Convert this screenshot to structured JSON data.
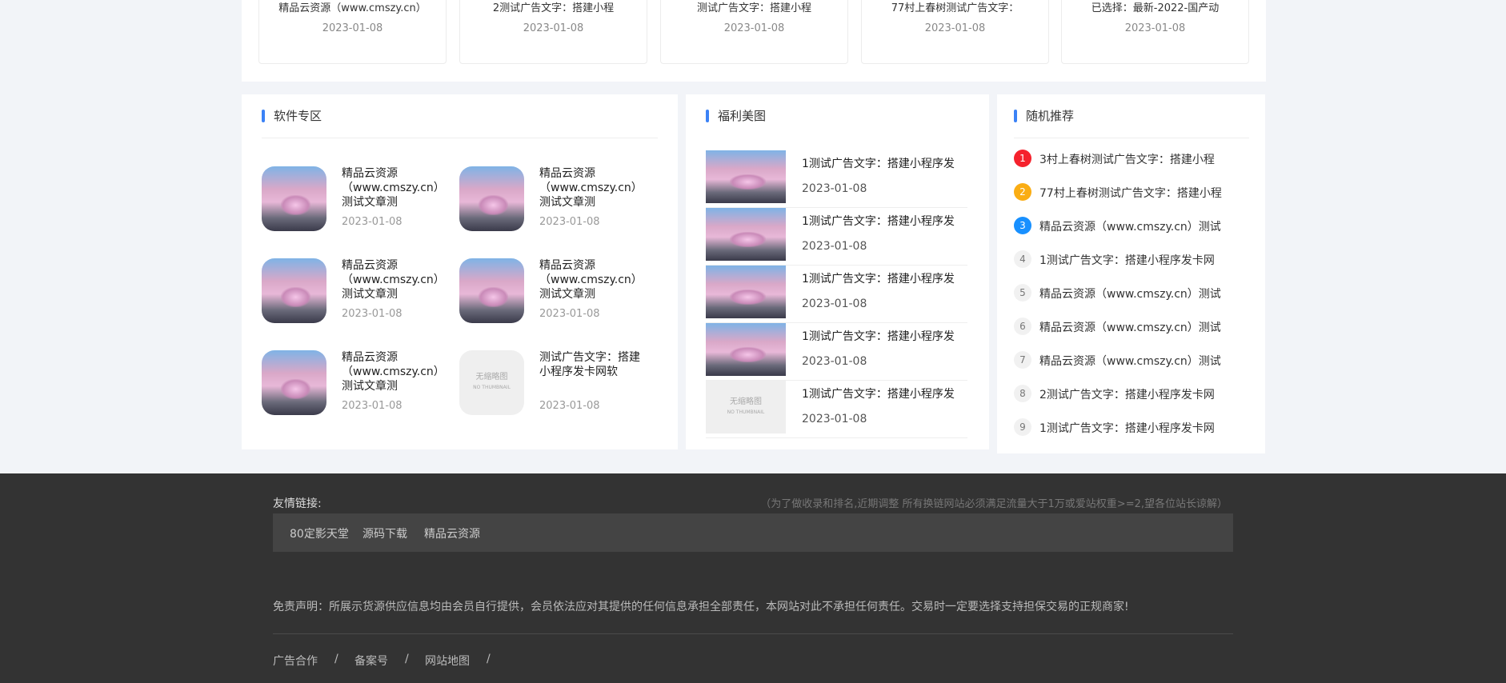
{
  "top_cards": [
    {
      "title": "精品云资源（www.cmszy.cn）",
      "date": "2023-01-08"
    },
    {
      "title": "2测试广告文字：搭建小程",
      "date": "2023-01-08"
    },
    {
      "title": "测试广告文字：搭建小程",
      "date": "2023-01-08"
    },
    {
      "title": "77村上春树测试广告文字：",
      "date": "2023-01-08"
    },
    {
      "title": "已选择：最新-2022-国产动",
      "date": "2023-01-08"
    }
  ],
  "software": {
    "title": "软件专区",
    "items": [
      {
        "title": "精品云资源（www.cmszy.cn）测试文章测",
        "date": "2023-01-08",
        "thumb": "car"
      },
      {
        "title": "精品云资源（www.cmszy.cn）测试文章测",
        "date": "2023-01-08",
        "thumb": "car"
      },
      {
        "title": "精品云资源（www.cmszy.cn）测试文章测",
        "date": "2023-01-08",
        "thumb": "car"
      },
      {
        "title": "精品云资源（www.cmszy.cn）测试文章测",
        "date": "2023-01-08",
        "thumb": "car"
      },
      {
        "title": "精品云资源（www.cmszy.cn）测试文章测",
        "date": "2023-01-08",
        "thumb": "car"
      },
      {
        "title": "测试广告文字：搭建小程序发卡网软",
        "date": "2023-01-08",
        "thumb": "none"
      }
    ]
  },
  "fuli": {
    "title": "福利美图",
    "items": [
      {
        "title": "1测试广告文字：搭建小程序发",
        "date": "2023-01-08",
        "thumb": "car"
      },
      {
        "title": "1测试广告文字：搭建小程序发",
        "date": "2023-01-08",
        "thumb": "car"
      },
      {
        "title": "1测试广告文字：搭建小程序发",
        "date": "2023-01-08",
        "thumb": "car"
      },
      {
        "title": "1测试广告文字：搭建小程序发",
        "date": "2023-01-08",
        "thumb": "car"
      },
      {
        "title": "1测试广告文字：搭建小程序发",
        "date": "2023-01-08",
        "thumb": "none"
      }
    ]
  },
  "random": {
    "title": "随机推荐",
    "items": [
      {
        "num": "1",
        "title": "3村上春树测试广告文字：搭建小程"
      },
      {
        "num": "2",
        "title": "77村上春树测试广告文字：搭建小程"
      },
      {
        "num": "3",
        "title": "精品云资源（www.cmszy.cn）测试"
      },
      {
        "num": "4",
        "title": "1测试广告文字：搭建小程序发卡网"
      },
      {
        "num": "5",
        "title": "精品云资源（www.cmszy.cn）测试"
      },
      {
        "num": "6",
        "title": "精品云资源（www.cmszy.cn）测试"
      },
      {
        "num": "7",
        "title": "精品云资源（www.cmszy.cn）测试"
      },
      {
        "num": "8",
        "title": "2测试广告文字：搭建小程序发卡网"
      },
      {
        "num": "9",
        "title": "1测试广告文字：搭建小程序发卡网"
      }
    ],
    "rank_colors": [
      "#f5222d",
      "#faad14",
      "#1890ff"
    ]
  },
  "no_thumb_text": "无缩略图",
  "no_thumb_sub": "NO THUMBNAIL",
  "footer": {
    "links_label": "友情链接:",
    "links_note": "（为了做收录和排名,近期调整 所有换链网站必须满足流量大于1万或爱站权重>=2,望各位站长谅解）",
    "links": [
      "80定影天堂",
      "源码下载",
      "精品云资源"
    ],
    "disclaimer": "免责声明：所展示货源供应信息均由会员自行提供，会员依法应对其提供的任何信息承担全部责任，本网站对此不承担任何责任。交易时一定要选择支持担保交易的正规商家!",
    "bottom_links": [
      "广告合作",
      "备案号",
      "网站地图"
    ],
    "separator": "/"
  }
}
